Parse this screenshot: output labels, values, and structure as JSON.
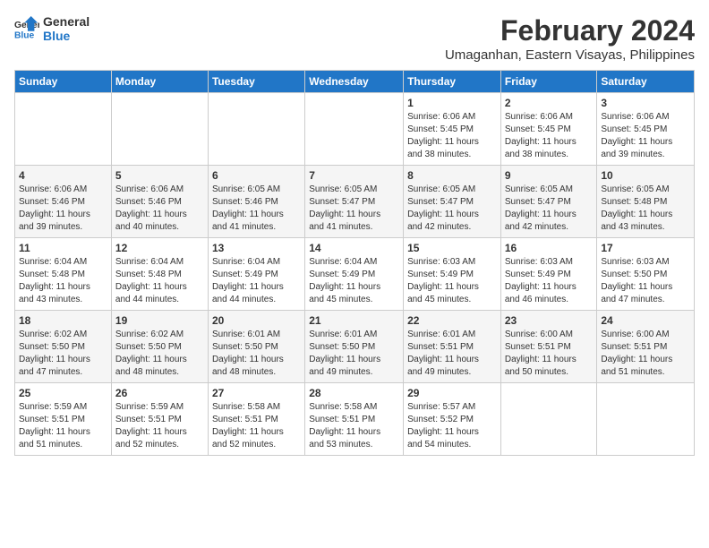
{
  "logo": {
    "line1": "General",
    "line2": "Blue"
  },
  "title": "February 2024",
  "subtitle": "Umaganhan, Eastern Visayas, Philippines",
  "weekdays": [
    "Sunday",
    "Monday",
    "Tuesday",
    "Wednesday",
    "Thursday",
    "Friday",
    "Saturday"
  ],
  "weeks": [
    [
      {
        "day": "",
        "info": ""
      },
      {
        "day": "",
        "info": ""
      },
      {
        "day": "",
        "info": ""
      },
      {
        "day": "",
        "info": ""
      },
      {
        "day": "1",
        "info": "Sunrise: 6:06 AM\nSunset: 5:45 PM\nDaylight: 11 hours\nand 38 minutes."
      },
      {
        "day": "2",
        "info": "Sunrise: 6:06 AM\nSunset: 5:45 PM\nDaylight: 11 hours\nand 38 minutes."
      },
      {
        "day": "3",
        "info": "Sunrise: 6:06 AM\nSunset: 5:45 PM\nDaylight: 11 hours\nand 39 minutes."
      }
    ],
    [
      {
        "day": "4",
        "info": "Sunrise: 6:06 AM\nSunset: 5:46 PM\nDaylight: 11 hours\nand 39 minutes."
      },
      {
        "day": "5",
        "info": "Sunrise: 6:06 AM\nSunset: 5:46 PM\nDaylight: 11 hours\nand 40 minutes."
      },
      {
        "day": "6",
        "info": "Sunrise: 6:05 AM\nSunset: 5:46 PM\nDaylight: 11 hours\nand 41 minutes."
      },
      {
        "day": "7",
        "info": "Sunrise: 6:05 AM\nSunset: 5:47 PM\nDaylight: 11 hours\nand 41 minutes."
      },
      {
        "day": "8",
        "info": "Sunrise: 6:05 AM\nSunset: 5:47 PM\nDaylight: 11 hours\nand 42 minutes."
      },
      {
        "day": "9",
        "info": "Sunrise: 6:05 AM\nSunset: 5:47 PM\nDaylight: 11 hours\nand 42 minutes."
      },
      {
        "day": "10",
        "info": "Sunrise: 6:05 AM\nSunset: 5:48 PM\nDaylight: 11 hours\nand 43 minutes."
      }
    ],
    [
      {
        "day": "11",
        "info": "Sunrise: 6:04 AM\nSunset: 5:48 PM\nDaylight: 11 hours\nand 43 minutes."
      },
      {
        "day": "12",
        "info": "Sunrise: 6:04 AM\nSunset: 5:48 PM\nDaylight: 11 hours\nand 44 minutes."
      },
      {
        "day": "13",
        "info": "Sunrise: 6:04 AM\nSunset: 5:49 PM\nDaylight: 11 hours\nand 44 minutes."
      },
      {
        "day": "14",
        "info": "Sunrise: 6:04 AM\nSunset: 5:49 PM\nDaylight: 11 hours\nand 45 minutes."
      },
      {
        "day": "15",
        "info": "Sunrise: 6:03 AM\nSunset: 5:49 PM\nDaylight: 11 hours\nand 45 minutes."
      },
      {
        "day": "16",
        "info": "Sunrise: 6:03 AM\nSunset: 5:49 PM\nDaylight: 11 hours\nand 46 minutes."
      },
      {
        "day": "17",
        "info": "Sunrise: 6:03 AM\nSunset: 5:50 PM\nDaylight: 11 hours\nand 47 minutes."
      }
    ],
    [
      {
        "day": "18",
        "info": "Sunrise: 6:02 AM\nSunset: 5:50 PM\nDaylight: 11 hours\nand 47 minutes."
      },
      {
        "day": "19",
        "info": "Sunrise: 6:02 AM\nSunset: 5:50 PM\nDaylight: 11 hours\nand 48 minutes."
      },
      {
        "day": "20",
        "info": "Sunrise: 6:01 AM\nSunset: 5:50 PM\nDaylight: 11 hours\nand 48 minutes."
      },
      {
        "day": "21",
        "info": "Sunrise: 6:01 AM\nSunset: 5:50 PM\nDaylight: 11 hours\nand 49 minutes."
      },
      {
        "day": "22",
        "info": "Sunrise: 6:01 AM\nSunset: 5:51 PM\nDaylight: 11 hours\nand 49 minutes."
      },
      {
        "day": "23",
        "info": "Sunrise: 6:00 AM\nSunset: 5:51 PM\nDaylight: 11 hours\nand 50 minutes."
      },
      {
        "day": "24",
        "info": "Sunrise: 6:00 AM\nSunset: 5:51 PM\nDaylight: 11 hours\nand 51 minutes."
      }
    ],
    [
      {
        "day": "25",
        "info": "Sunrise: 5:59 AM\nSunset: 5:51 PM\nDaylight: 11 hours\nand 51 minutes."
      },
      {
        "day": "26",
        "info": "Sunrise: 5:59 AM\nSunset: 5:51 PM\nDaylight: 11 hours\nand 52 minutes."
      },
      {
        "day": "27",
        "info": "Sunrise: 5:58 AM\nSunset: 5:51 PM\nDaylight: 11 hours\nand 52 minutes."
      },
      {
        "day": "28",
        "info": "Sunrise: 5:58 AM\nSunset: 5:51 PM\nDaylight: 11 hours\nand 53 minutes."
      },
      {
        "day": "29",
        "info": "Sunrise: 5:57 AM\nSunset: 5:52 PM\nDaylight: 11 hours\nand 54 minutes."
      },
      {
        "day": "",
        "info": ""
      },
      {
        "day": "",
        "info": ""
      }
    ]
  ]
}
